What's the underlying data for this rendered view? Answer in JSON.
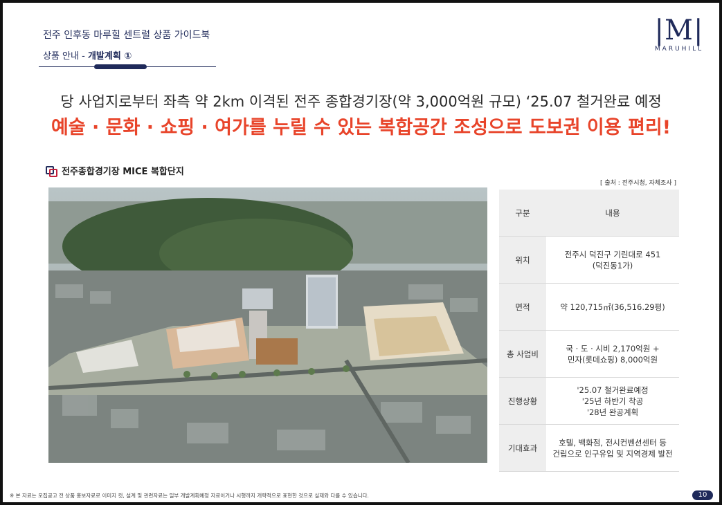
{
  "header": {
    "title": "전주 인후동 마루힐 센트럴 상품 가이드북",
    "sub_prefix": "상품 안내 - ",
    "sub_active": "개발계획 ①"
  },
  "logo": {
    "mark": "|M|",
    "word": "MARUHILL"
  },
  "headline": {
    "line1": "당 사업지로부터 좌측 약 2km 이격된 전주 종합경기장(약 3,000억원 규모) ‘25.07 철거완료 예정",
    "line2": "예술 · 문화 · 쇼핑 · 여가를 누릴 수 있는 복합공간 조성으로 도보권 이용 편리!"
  },
  "section": {
    "title": "전주종합경기장 MICE 복합단지"
  },
  "source": "[ 출처 : 전주시청, 자체조사 ]",
  "table": {
    "head": [
      "구분",
      "내용"
    ],
    "rows": [
      {
        "key": "위치",
        "line1": "전주시 덕진구 기린대로 451",
        "line2": "(덕진동1가)"
      },
      {
        "key": "면적",
        "line1": "약 120,715㎡(36,516.29평)",
        "line2": ""
      },
      {
        "key": "총 사업비",
        "line1": "국 · 도 · 시비 2,170억원 +",
        "line2": "민자(롯데쇼핑) 8,000억원"
      },
      {
        "key": "진행상황",
        "line1": "'25.07 철거완료예정",
        "line2": "'25년 하반기 착공",
        "line3": "'28년 완공계획"
      },
      {
        "key": "기대효과",
        "line1": "호텔, 백화점, 전시컨벤션센터 등",
        "line2": "건립으로 인구유입 및 지역경제 발전"
      }
    ]
  },
  "footnote": "※ 본 자료는 모집공고 전 상품 홍보자료로 이미지 컷, 설계 및 관련자료는 일부 개발계획예정 자료이거나 시행까지 개략적으로 표현한 것으로 실제와 다를 수 있습니다.",
  "page_number": "10",
  "colors": {
    "navy": "#1f2a5a",
    "accent_red": "#e8442a",
    "table_bg": "#eeeeee"
  }
}
